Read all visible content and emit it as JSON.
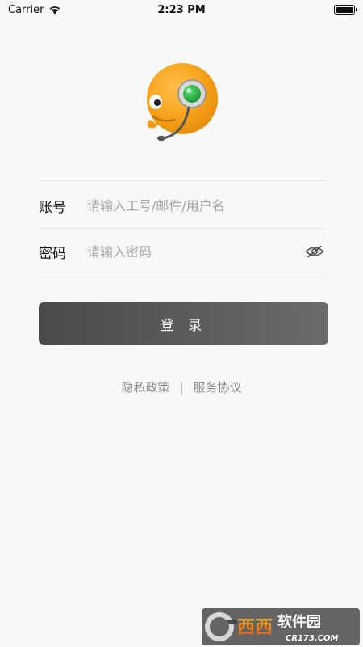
{
  "status_bar": {
    "carrier": "Carrier",
    "time": "2:23 PM",
    "battery_level": 1.0
  },
  "login_form": {
    "account": {
      "label": "账号",
      "placeholder": "请输入工号/邮件/用户名",
      "value": ""
    },
    "password": {
      "label": "密码",
      "placeholder": "请输入密码",
      "value": "",
      "toggle_icon": "eye-hidden-icon"
    },
    "submit_label": "登 录"
  },
  "footer_links": {
    "privacy": "隐私政策",
    "separator": "|",
    "terms": "服务协议"
  },
  "watermark": {
    "brand": "西西软件园",
    "domain": "CR173.COM"
  },
  "colors": {
    "background": "#f8f8f8",
    "logo_orange": "#f7a21b",
    "logo_green": "#2bb34a",
    "button_dark": "#4a4a4a",
    "button_light": "#6b6b6b",
    "placeholder": "#a3a3a3",
    "link_gray": "#8a8a8a"
  }
}
